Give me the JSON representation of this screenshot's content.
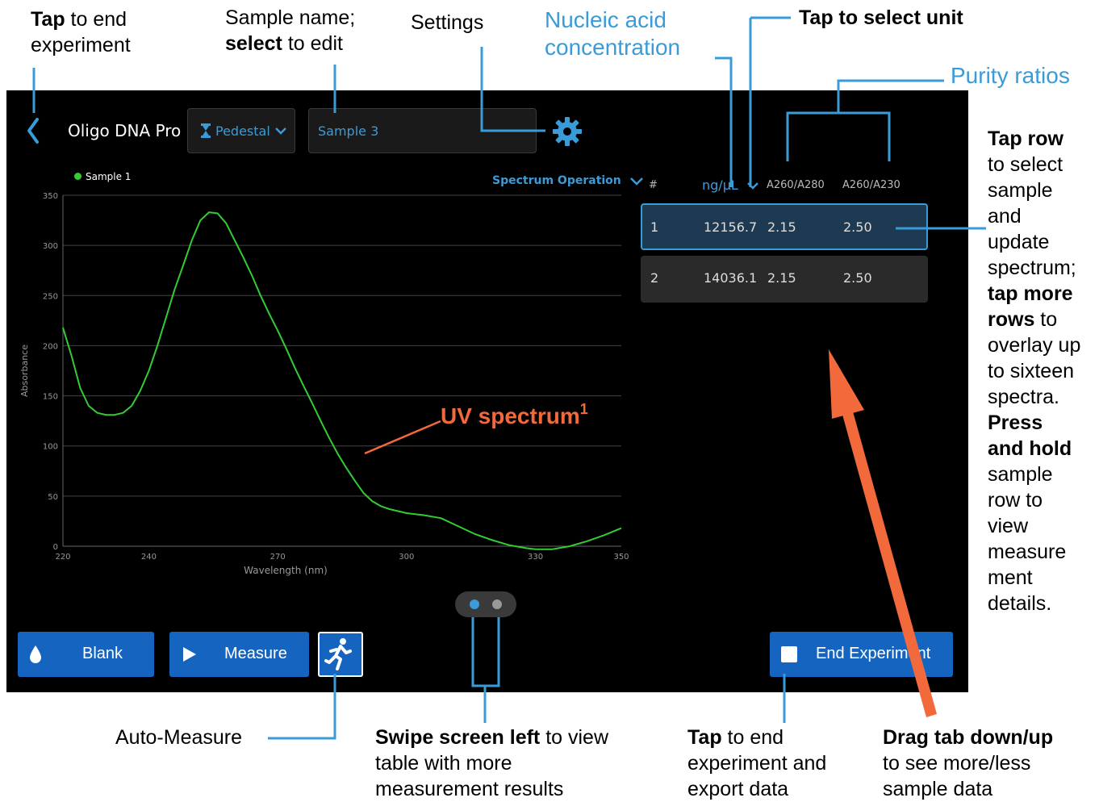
{
  "app": {
    "title": "Oligo DNA Pro",
    "mode": "Pedestal",
    "sample_name": "Sample 3",
    "spectrum_menu": "Spectrum Operation"
  },
  "chart_data": {
    "type": "line",
    "legend": [
      "Sample 1"
    ],
    "xlabel": "Wavelength (nm)",
    "ylabel": "Absorbance",
    "xlim": [
      220,
      350
    ],
    "ylim": [
      0,
      350
    ],
    "x_ticks": [
      220,
      240,
      270,
      300,
      330,
      350
    ],
    "y_ticks": [
      0,
      50,
      100,
      150,
      200,
      250,
      300,
      350
    ],
    "grid": "horizontal",
    "series": [
      {
        "name": "Sample 1",
        "color": "#33cc33",
        "x": [
          220,
          222,
          224,
          226,
          228,
          230,
          232,
          234,
          236,
          238,
          240,
          242,
          244,
          246,
          248,
          250,
          252,
          254,
          256,
          258,
          260,
          262,
          264,
          266,
          268,
          270,
          272,
          274,
          276,
          278,
          280,
          282,
          284,
          286,
          288,
          290,
          292,
          294,
          296,
          298,
          300,
          304,
          308,
          312,
          316,
          320,
          324,
          328,
          330,
          334,
          338,
          342,
          346,
          350
        ],
        "y": [
          218,
          190,
          158,
          140,
          133,
          131,
          131,
          133,
          140,
          155,
          175,
          200,
          228,
          256,
          280,
          305,
          325,
          333,
          332,
          322,
          305,
          288,
          270,
          250,
          232,
          215,
          197,
          178,
          160,
          143,
          125,
          108,
          92,
          78,
          65,
          53,
          45,
          40,
          37,
          35,
          33,
          31,
          28,
          20,
          12,
          6,
          1,
          -2,
          -3,
          -3,
          0,
          5,
          11,
          18
        ]
      }
    ]
  },
  "table": {
    "headers": [
      "#",
      "ng/µL",
      "A260/A280",
      "A260/A230"
    ],
    "rows": [
      {
        "num": "1",
        "conc": "12156.7",
        "a280": "2.15",
        "a230": "2.50"
      },
      {
        "num": "2",
        "conc": "14036.1",
        "a280": "2.15",
        "a230": "2.50"
      }
    ]
  },
  "buttons": {
    "blank": "Blank",
    "measure": "Measure",
    "end": "End Experiment"
  },
  "callouts": {
    "back_b": "Tap",
    "back_t": "to end",
    "back_2": "experiment",
    "sample_1": "Sample name;",
    "sample_b": "select",
    "sample_t": "to edit",
    "settings": "Settings",
    "nucleic_1": "Nucleic acid",
    "nucleic_2": "concentration",
    "unit": "Tap to select unit",
    "purity": "Purity ratios",
    "tap_row": [
      "Tap row",
      "to select",
      "sample",
      "and",
      "update",
      "spectrum;",
      "tap more",
      "rows to",
      "overlay up",
      "to sixteen",
      "spectra.",
      "Press",
      "and hold",
      "sample",
      "row to",
      "view",
      "measure",
      "ment",
      "details."
    ],
    "uv": "UV spectrum",
    "uv_sup": "1",
    "auto": "Auto-Measure",
    "swipe_b": "Swipe screen left",
    "swipe_t": "to view",
    "swipe_2": "table with more",
    "swipe_3": "measurement results",
    "end_b": "Tap",
    "end_t": "to end",
    "end_2": "experiment and",
    "end_3": "export data",
    "drag_b": "Drag tab down/up",
    "drag_2": "to see more/less",
    "drag_3": "sample data"
  },
  "colors": {
    "accent": "#3a9bd9",
    "button": "#1565c0",
    "spectrum": "#33cc33",
    "annotation": "#f26a3c"
  }
}
